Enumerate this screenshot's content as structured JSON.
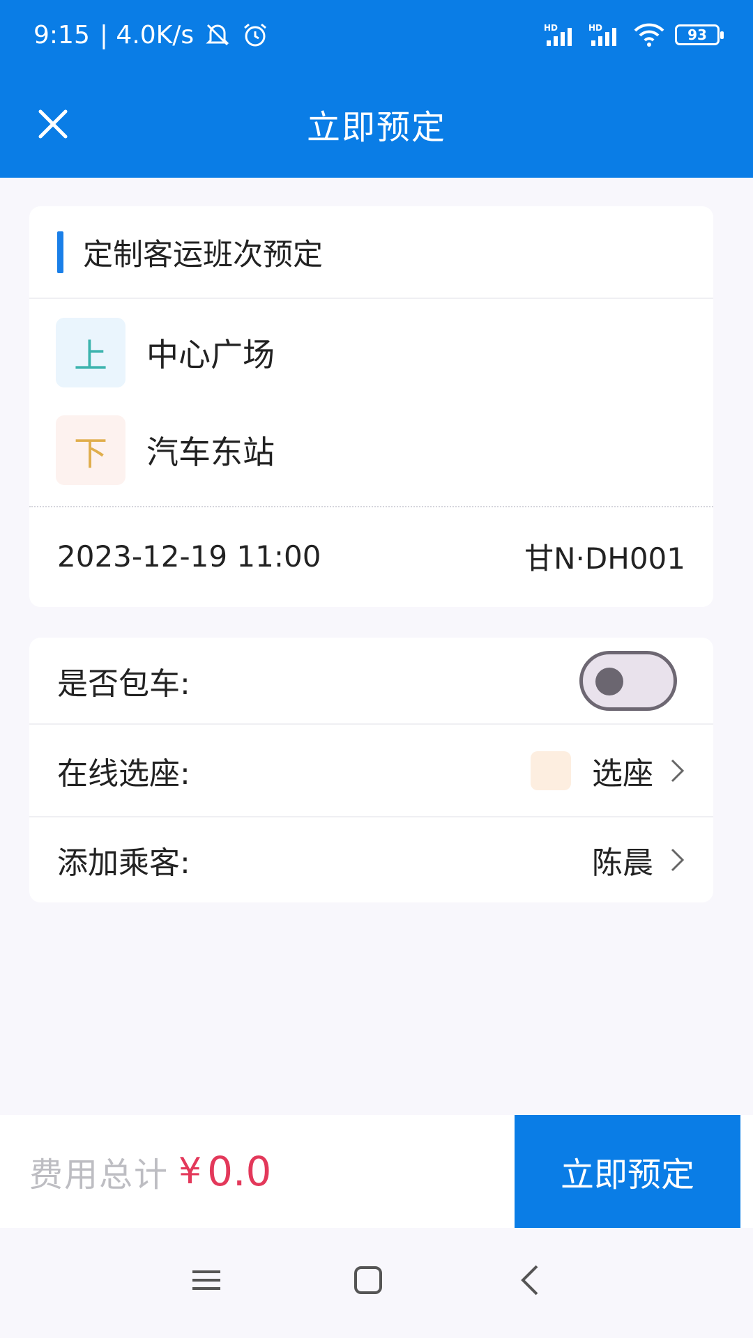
{
  "status_bar": {
    "time": "9:15",
    "speed": "| 4.0K/s",
    "battery": "93",
    "signal1_label": "HD",
    "signal2_label": "HD"
  },
  "nav": {
    "title": "立即预定"
  },
  "trip_card": {
    "title": "定制客运班次预定",
    "boarding_badge": "上",
    "boarding_stop": "中心广场",
    "alighting_badge": "下",
    "alighting_stop": "汽车东站",
    "datetime": "2023-12-19 11:00",
    "vehicle_plate": "甘N·DH001"
  },
  "options": {
    "charter_label": "是否包车:",
    "charter_enabled": false,
    "seat_label": "在线选座:",
    "seat_value": "选座",
    "passenger_label": "添加乘客:",
    "passenger_value": "陈晨"
  },
  "bottom": {
    "total_label": "费用总计",
    "currency": "¥",
    "total_value": "0.0",
    "book_button": "立即预定"
  },
  "colors": {
    "primary": "#0a7de6",
    "price": "#e3385a",
    "boarding_badge_text": "#3bb3ad",
    "alighting_badge_text": "#e0ae4c"
  }
}
